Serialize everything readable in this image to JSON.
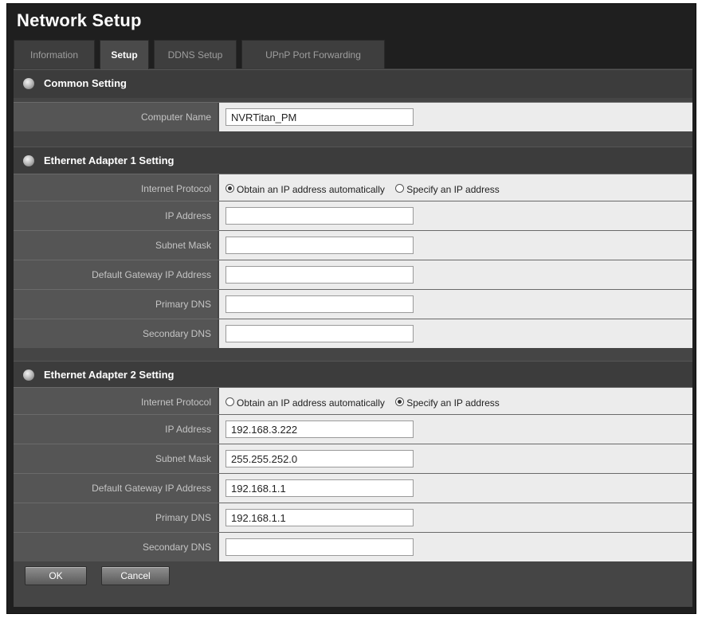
{
  "window": {
    "title": "Network Setup"
  },
  "tabs": [
    {
      "label": "Information"
    },
    {
      "label": "Setup",
      "active": true
    },
    {
      "label": "DDNS Setup"
    },
    {
      "label": "UPnP Port Forwarding"
    }
  ],
  "common": {
    "title": "Common Setting",
    "computer_name_label": "Computer Name",
    "computer_name_value": "NVRTitan_PM"
  },
  "eth1": {
    "title": "Ethernet Adapter 1 Setting",
    "protocol_label": "Internet Protocol",
    "option_auto": "Obtain an IP address automatically",
    "option_static": "Specify an IP address",
    "selected": "auto",
    "ip_label": "IP Address",
    "ip_value": "",
    "mask_label": "Subnet Mask",
    "mask_value": "",
    "gateway_label": "Default Gateway IP Address",
    "gateway_value": "",
    "dns1_label": "Primary DNS",
    "dns1_value": "",
    "dns2_label": "Secondary DNS",
    "dns2_value": ""
  },
  "eth2": {
    "title": "Ethernet Adapter 2 Setting",
    "protocol_label": "Internet Protocol",
    "option_auto": "Obtain an IP address automatically",
    "option_static": "Specify an IP address",
    "selected": "static",
    "ip_label": "IP Address",
    "ip_value": "192.168.3.222",
    "mask_label": "Subnet Mask",
    "mask_value": "255.255.252.0",
    "gateway_label": "Default Gateway IP Address",
    "gateway_value": "192.168.1.1",
    "dns1_label": "Primary DNS",
    "dns1_value": "192.168.1.1",
    "dns2_label": "Secondary DNS",
    "dns2_value": ""
  },
  "buttons": {
    "ok": "OK",
    "cancel": "Cancel"
  }
}
